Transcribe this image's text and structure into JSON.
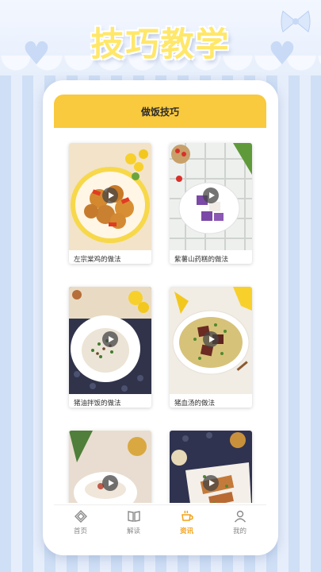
{
  "page": {
    "title": "技巧教学"
  },
  "screen": {
    "header_title": "做饭技巧",
    "cards": [
      {
        "title": "左宗棠鸡的做法"
      },
      {
        "title": "紫薯山药糕的做法"
      },
      {
        "title": "猪油拌饭的做法"
      },
      {
        "title": "猪血汤的做法"
      },
      {
        "title": ""
      },
      {
        "title": ""
      }
    ]
  },
  "tabbar": {
    "items": [
      {
        "label": "首页",
        "icon": "home-icon"
      },
      {
        "label": "解读",
        "icon": "book-icon"
      },
      {
        "label": "资讯",
        "icon": "coffee-cup-icon",
        "active": true
      },
      {
        "label": "我的",
        "icon": "user-icon"
      }
    ]
  },
  "colors": {
    "accent": "#f9c93e",
    "active_tab": "#f2a11a",
    "background_stripe_light": "#e6eefb",
    "background_stripe_dark": "#cfdff5",
    "title_yellow": "#ffe76a"
  }
}
